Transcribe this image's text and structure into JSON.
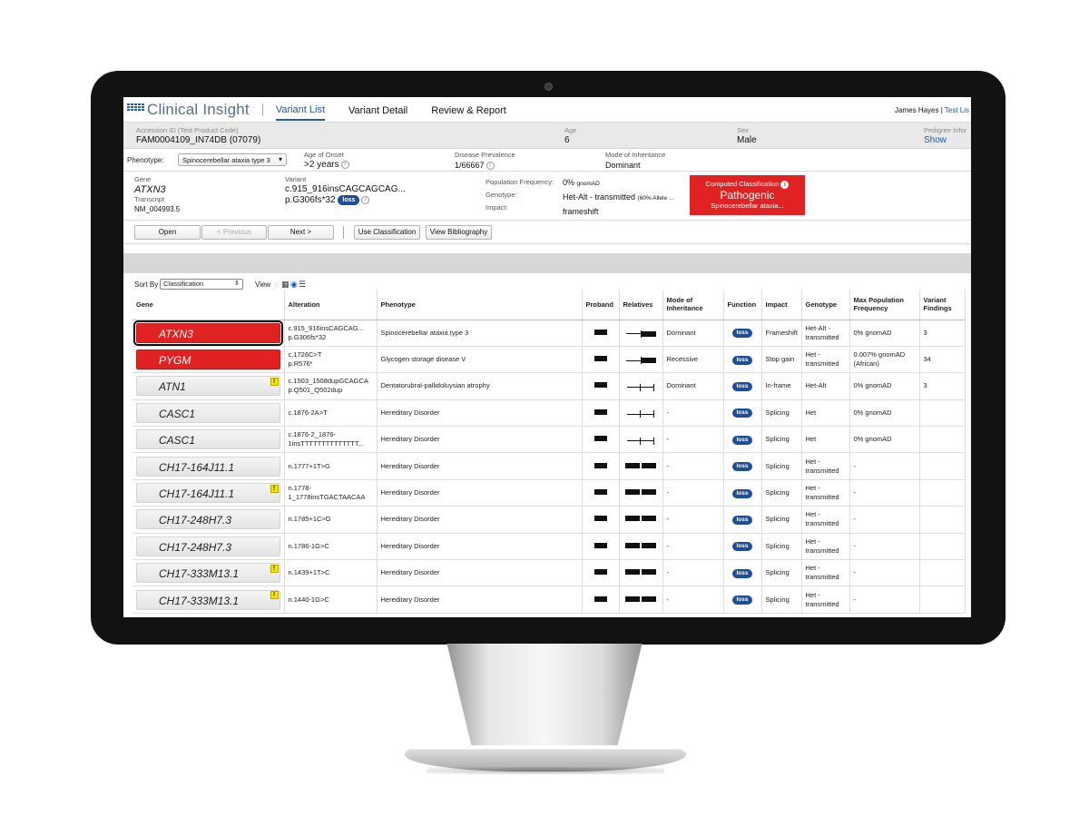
{
  "app": {
    "logo_text": "Clinical Insight",
    "tabs": [
      "Variant List",
      "Variant Detail",
      "Review & Report"
    ],
    "active_tab": "Variant List",
    "user_name": "James Hayes |",
    "user_link": "Test Lis"
  },
  "patient": {
    "accession_label": "Accession ID (Test Product Code)",
    "accession_value": "FAM0004109_IN74DB  (07079)",
    "age_label": "Age",
    "age_value": "6",
    "sex_label": "Sex",
    "sex_value": "Male",
    "pedigree_label": "Pedigree Infor",
    "pedigree_link": "Show"
  },
  "phenotype": {
    "label": "Phenotype:",
    "selected": "Spinocerebellar ataxia type 3",
    "onset_label": "Age of Onset",
    "onset_value": ">2 years",
    "prevalence_label": "Disease Prevalence",
    "prevalence_value": "1/66667",
    "inheritance_label": "Mode of Inheritance",
    "inheritance_value": "Dominant"
  },
  "variant": {
    "gene_label": "Gene",
    "gene_value": "ATXN3",
    "transcript_label": "Transcript",
    "transcript_value": "NM_004993.5",
    "variant_label": "Variant",
    "variant_c": "c.915_916insCAGCAGCAG...",
    "variant_p": "p.G306fs*32",
    "variant_badge": "loss",
    "popfreq_label": "Population Frequency:",
    "popfreq_value": "0%",
    "popfreq_source": "gnomAD",
    "genotype_label": "Genotype:",
    "genotype_value": "Het-Alt - transmitted",
    "genotype_extra": "(60% Allele ...",
    "impact_label": "Impact:",
    "impact_value": "frameshift",
    "classification_title": "Computed Classification",
    "classification_value": "Pathogenic",
    "classification_disease": "Spinocerebellar ataxia..."
  },
  "toolbar": {
    "open": "Open",
    "previous": "< Previous",
    "next": "Next >",
    "use_classification": "Use Classification",
    "view_bibliography": "View Bibliography"
  },
  "sort": {
    "label": "Sort By",
    "selected": "Classification",
    "view_label": "View"
  },
  "table": {
    "headers": [
      "Gene",
      "Alteration",
      "Phenotype",
      "Proband",
      "Relatives",
      "Mode of Inheritance",
      "Function",
      "Impact",
      "Genotype",
      "Max Population Frequency",
      "Variant Findings"
    ],
    "rows": [
      {
        "gene": "ATXN3",
        "alt1": "c.915_916insCAGCAG...",
        "alt2": "p.G306fs*32",
        "phenotype": "Spinocerebellar ataxia type 3",
        "moi": "Dominant",
        "function": "loss",
        "impact": "Frameshift",
        "genotype": "Het-Alt - transmitted",
        "freq": "0% gnomAD",
        "findings": "3"
      },
      {
        "gene": "PYGM",
        "alt1": "c.1726C>T",
        "alt2": "p.R576*",
        "phenotype": "Glycogen storage disease V",
        "moi": "Recessive",
        "function": "loss",
        "impact": "Stop gain",
        "genotype": "Het - transmitted",
        "freq": "0.007% gnomAD (African)",
        "findings": "34"
      },
      {
        "gene": "ATN1",
        "alt1": "c.1503_1508dupGCAGCA",
        "alt2": "p.Q501_Q502dup",
        "phenotype": "Dentatorubral-pallidoluysian atrophy",
        "moi": "Dominant",
        "function": "loss",
        "impact": "In-frame",
        "genotype": "Het-Alt",
        "freq": "0% gnomAD",
        "findings": "3"
      },
      {
        "gene": "CASC1",
        "alt1": "c.1876-2A>T",
        "alt2": "",
        "phenotype": "Hereditary Disorder",
        "moi": "-",
        "function": "loss",
        "impact": "Splicing",
        "genotype": "Het",
        "freq": "0% gnomAD",
        "findings": ""
      },
      {
        "gene": "CASC1",
        "alt1": "c.1876-2_1876-",
        "alt2": "1insTTTTTTTTTTTTTT...",
        "phenotype": "Hereditary Disorder",
        "moi": "-",
        "function": "loss",
        "impact": "Splicing",
        "genotype": "Het",
        "freq": "0% gnomAD",
        "findings": ""
      },
      {
        "gene": "CH17-164J11.1",
        "alt1": "n.1777+1T>G",
        "alt2": "",
        "phenotype": "Hereditary Disorder",
        "moi": "-",
        "function": "loss",
        "impact": "Splicing",
        "genotype": "Het - transmitted",
        "freq": "-",
        "findings": ""
      },
      {
        "gene": "CH17-164J11.1",
        "alt1": "n.1778-",
        "alt2": "1_1778insTGACTAACAA",
        "phenotype": "Hereditary Disorder",
        "moi": "-",
        "function": "loss",
        "impact": "Splicing",
        "genotype": "Het - transmitted",
        "freq": "-",
        "findings": ""
      },
      {
        "gene": "CH17-248H7.3",
        "alt1": "n.1785+1C>G",
        "alt2": "",
        "phenotype": "Hereditary Disorder",
        "moi": "-",
        "function": "loss",
        "impact": "Splicing",
        "genotype": "Het - transmitted",
        "freq": "-",
        "findings": ""
      },
      {
        "gene": "CH17-248H7.3",
        "alt1": "n.1786-1G>C",
        "alt2": "",
        "phenotype": "Hereditary Disorder",
        "moi": "-",
        "function": "loss",
        "impact": "Splicing",
        "genotype": "Het - transmitted",
        "freq": "-",
        "findings": ""
      },
      {
        "gene": "CH17-333M13.1",
        "alt1": "n.1439+1T>C",
        "alt2": "",
        "phenotype": "Hereditary Disorder",
        "moi": "-",
        "function": "loss",
        "impact": "Splicing",
        "genotype": "Het - transmitted",
        "freq": "-",
        "findings": ""
      },
      {
        "gene": "CH17-333M13.1",
        "alt1": "n.1440-1G>C",
        "alt2": "",
        "phenotype": "Hereditary Disorder",
        "moi": "-",
        "function": "loss",
        "impact": "Splicing",
        "genotype": "Het - transmitted",
        "freq": "-",
        "findings": ""
      }
    ]
  }
}
